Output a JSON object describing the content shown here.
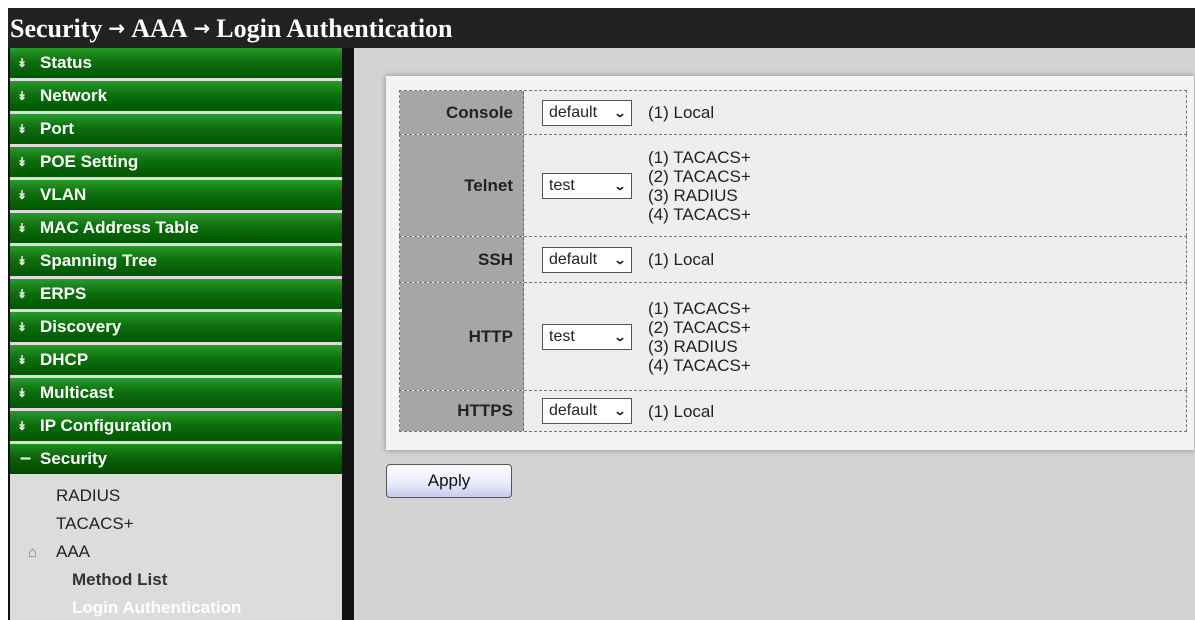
{
  "title": {
    "part1": "Security",
    "part2": "AAA",
    "part3": "Login Authentication",
    "separator": "→"
  },
  "sidebar": {
    "menu": [
      {
        "label": "Status"
      },
      {
        "label": "Network"
      },
      {
        "label": "Port"
      },
      {
        "label": "POE Setting"
      },
      {
        "label": "VLAN"
      },
      {
        "label": "MAC Address Table"
      },
      {
        "label": "Spanning Tree"
      },
      {
        "label": "ERPS"
      },
      {
        "label": "Discovery"
      },
      {
        "label": "DHCP"
      },
      {
        "label": "Multicast"
      },
      {
        "label": "IP Configuration"
      }
    ],
    "open_section": {
      "label": "Security"
    },
    "sub": {
      "radius": "RADIUS",
      "tacacs": "TACACS+",
      "aaa": "AAA",
      "method_list": "Method List",
      "login_auth": "Login Authentication"
    }
  },
  "form": {
    "rows": [
      {
        "label": "Console",
        "selected": "default",
        "methods": [
          "(1) Local"
        ]
      },
      {
        "label": "Telnet",
        "selected": "test",
        "methods": [
          "(1) TACACS+",
          "(2) TACACS+",
          "(3) RADIUS",
          "(4) TACACS+"
        ]
      },
      {
        "label": "SSH",
        "selected": "default",
        "methods": [
          "(1) Local"
        ]
      },
      {
        "label": "HTTP",
        "selected": "test",
        "methods": [
          "(1) TACACS+",
          "(2) TACACS+",
          "(3) RADIUS",
          "(4) TACACS+"
        ]
      },
      {
        "label": "HTTPS",
        "selected": "default",
        "methods": [
          "(1) Local"
        ]
      }
    ]
  },
  "apply_label": "Apply",
  "icons": {
    "menu_chevron": "chevron-down-double-icon",
    "select_caret": "caret-down-icon",
    "current_node": "home-icon"
  },
  "colors": {
    "menu_green": "#0e6f0e",
    "title_bg": "#222222",
    "label_bg": "#a6a6a6",
    "main_bg": "#d3d3d3"
  }
}
